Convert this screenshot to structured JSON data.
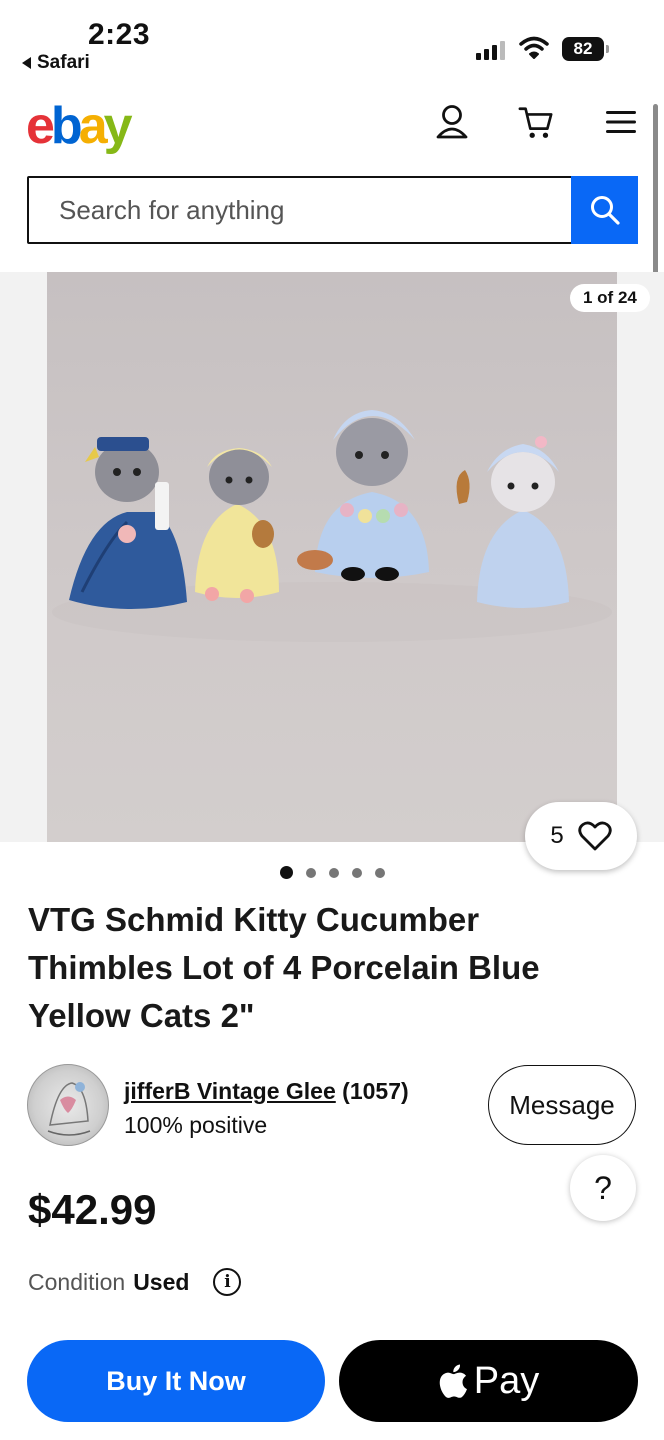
{
  "status_bar": {
    "time": "2:23",
    "back_app": "Safari",
    "battery": "82"
  },
  "header": {
    "logo": {
      "e": "e",
      "b": "b",
      "a": "a",
      "y": "y"
    },
    "icons": [
      "account-icon",
      "cart-icon",
      "menu-icon"
    ]
  },
  "search": {
    "placeholder": "Search for anything"
  },
  "gallery": {
    "counter": "1 of 24",
    "watch_count": "5",
    "dots_total": 5,
    "dots_active": 1
  },
  "listing": {
    "title": "VTG Schmid Kitty Cucumber Thimbles Lot of 4 Porcelain Blue Yellow Cats 2\"",
    "price": "$42.99",
    "condition_label": "Condition",
    "condition_value": "Used"
  },
  "seller": {
    "name": "jifferB Vintage Glee",
    "score": "(1057)",
    "feedback": "100% positive",
    "message_label": "Message"
  },
  "help_label": "?",
  "actions": {
    "buy_label": "Buy It Now",
    "pay_label": "Pay"
  },
  "colors": {
    "ebay_blue": "#0968f6",
    "logo_red": "#e53238",
    "logo_blue": "#0064d2",
    "logo_yellow": "#f5af02",
    "logo_green": "#86b817"
  }
}
